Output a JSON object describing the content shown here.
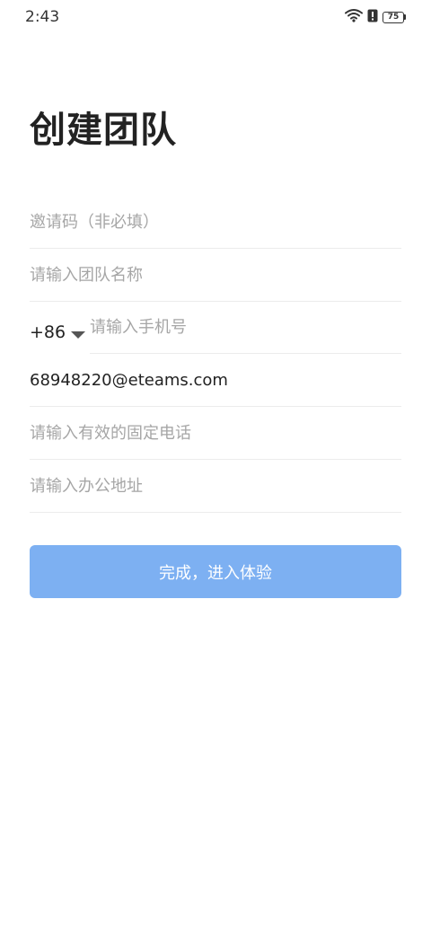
{
  "status_bar": {
    "time": "2:43",
    "icons": [
      "wifi-icon",
      "alert-icon",
      "battery-icon"
    ],
    "battery_level": "75"
  },
  "page": {
    "title": "创建团队"
  },
  "form": {
    "invite_code": {
      "placeholder": "邀请码（非必填）",
      "value": ""
    },
    "team_name": {
      "placeholder": "请输入团队名称",
      "value": ""
    },
    "country_code": "+86",
    "phone": {
      "placeholder": "请输入手机号",
      "value": ""
    },
    "email": {
      "placeholder": "",
      "value": "68948220@eteams.com"
    },
    "landline": {
      "placeholder": "请输入有效的固定电话",
      "value": ""
    },
    "address": {
      "placeholder": "请输入办公地址",
      "value": ""
    }
  },
  "submit_button": {
    "label": "完成，进入体验",
    "color": "#7db0f2",
    "text_color": "#ffffff"
  },
  "colors": {
    "placeholder": "#a6a6a6",
    "divider": "#ececec",
    "title": "#222222"
  }
}
